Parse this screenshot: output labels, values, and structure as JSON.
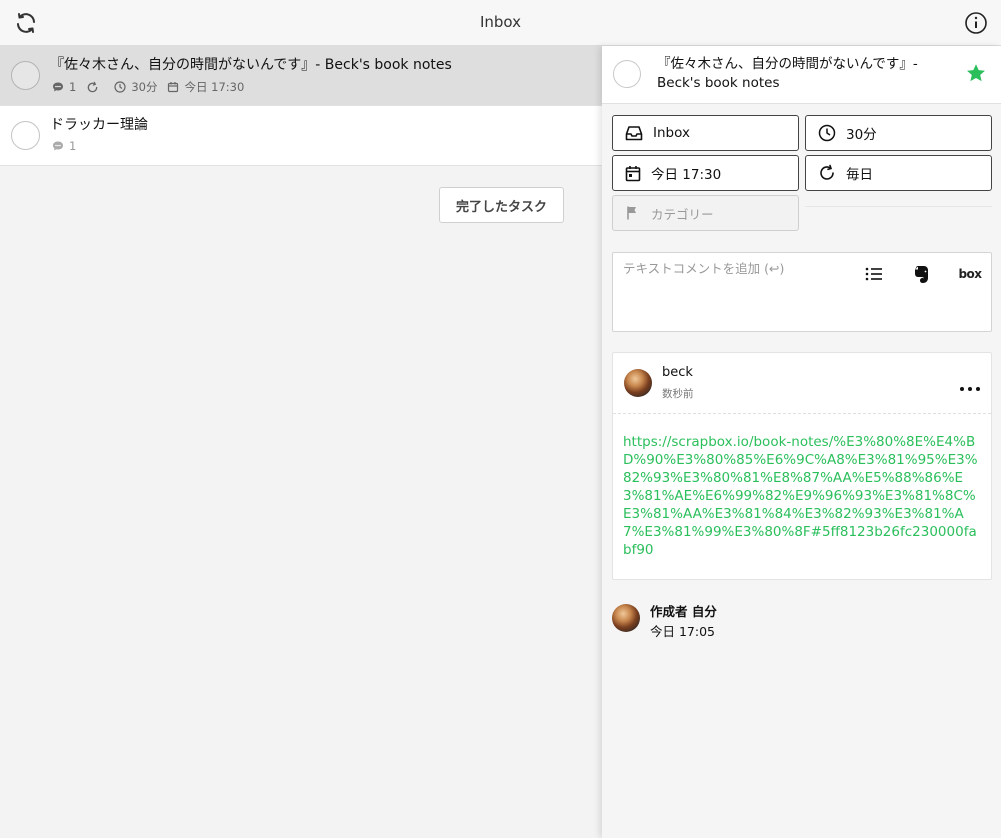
{
  "header": {
    "title": "Inbox"
  },
  "tasks": [
    {
      "name": "『佐々木さん、自分の時間がないんです』- Beck's book notes",
      "comments": "1",
      "duration": "30分",
      "date": "今日 17:30"
    },
    {
      "name": "ドラッカー理論",
      "comments": "1"
    }
  ],
  "done_button": "完了したタスク",
  "detail": {
    "title": "『佐々木さん、自分の時間がないんです』- Beck's book notes",
    "starred": true,
    "star_color": "#2bbf5c",
    "project": "Inbox",
    "duration": "30分",
    "date": "今日 17:30",
    "repeat": "毎日",
    "category_placeholder": "カテゴリー",
    "comment_placeholder": "テキストコメントを追加 (↩)",
    "comment_tools": {
      "box_label": "box"
    },
    "comment": {
      "author": "beck",
      "time": "数秒前",
      "link": "https://scrapbox.io/book-notes/%E3%80%8E%E4%BD%90%E3%80%85%E6%9C%A8%E3%81%95%E3%82%93%E3%80%81%E8%87%AA%E5%88%86%E3%81%AE%E6%99%82%E9%96%93%E3%81%8C%E3%81%AA%E3%81%84%E3%82%93%E3%81%A7%E3%81%99%E3%80%8F#5ff8123b26fc230000fabf90"
    },
    "creator": {
      "label": "作成者 自分",
      "time": "今日 17:05"
    }
  },
  "colors": {
    "accent": "#2bbf5c",
    "selected_row": "#dedede"
  },
  "icons": [
    "refresh-icon",
    "info-icon",
    "comment-icon",
    "repeat-icon",
    "clock-icon",
    "calendar-icon",
    "inbox-icon",
    "flag-icon",
    "list-icon",
    "evernote-icon",
    "star-icon",
    "more-icon"
  ]
}
